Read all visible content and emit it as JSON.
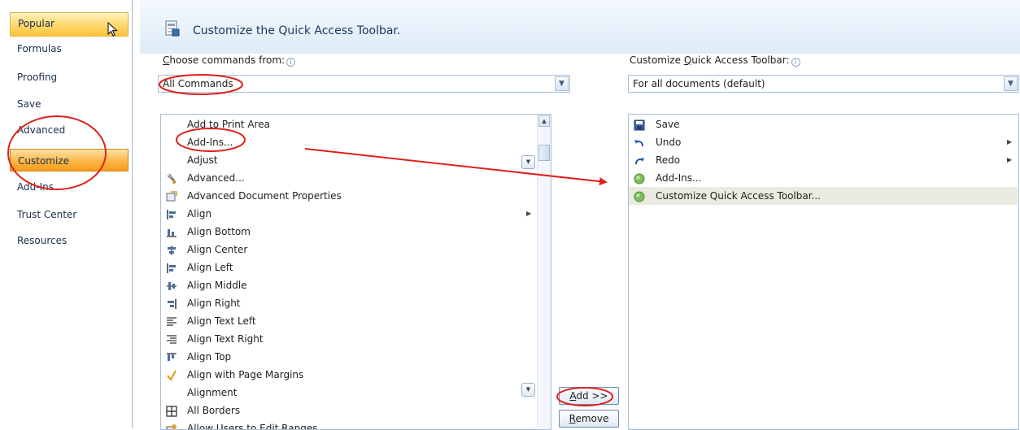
{
  "sidebar": {
    "items": [
      {
        "label": "Popular"
      },
      {
        "label": "Formulas"
      },
      {
        "label": "Proofing"
      },
      {
        "label": "Save"
      },
      {
        "label": "Advanced"
      },
      {
        "label": "Customize"
      },
      {
        "label": "Add-Ins"
      },
      {
        "label": "Trust Center"
      },
      {
        "label": "Resources"
      }
    ]
  },
  "header": {
    "title": "Customize the Quick Access Toolbar."
  },
  "choose": {
    "label_accel": "C",
    "label_rest": "hoose commands from:",
    "value": "All Commands"
  },
  "qat_target": {
    "label_pre": "Customize ",
    "label_accel": "Q",
    "label_rest": "uick Access Toolbar:",
    "value": "For all documents (default)"
  },
  "commands": [
    {
      "label": "Add to Print Area",
      "icon": "none"
    },
    {
      "label": "Add-Ins...",
      "icon": "none"
    },
    {
      "label": "Adjust",
      "icon": "none"
    },
    {
      "label": "Advanced...",
      "icon": "advanced-icon"
    },
    {
      "label": "Advanced Document Properties",
      "icon": "document-properties-icon"
    },
    {
      "label": "Align",
      "icon": "align-icon",
      "submenu": "▶"
    },
    {
      "label": "Align Bottom",
      "icon": "align-bottom-icon"
    },
    {
      "label": "Align Center",
      "icon": "align-center-icon"
    },
    {
      "label": "Align Left",
      "icon": "align-left-icon"
    },
    {
      "label": "Align Middle",
      "icon": "align-middle-icon"
    },
    {
      "label": "Align Right",
      "icon": "align-right-icon"
    },
    {
      "label": "Align Text Left",
      "icon": "align-text-left-icon"
    },
    {
      "label": "Align Text Right",
      "icon": "align-text-right-icon"
    },
    {
      "label": "Align Top",
      "icon": "align-top-icon"
    },
    {
      "label": "Align with Page Margins",
      "icon": "checkmark-icon"
    },
    {
      "label": "Alignment",
      "icon": "none"
    },
    {
      "label": "All Borders",
      "icon": "all-borders-icon"
    },
    {
      "label": "Allow Users to Edit Ranges...",
      "icon": "allow-edit-ranges-icon"
    }
  ],
  "qat_items": [
    {
      "label": "Save",
      "icon": "save-icon"
    },
    {
      "label": "Undo",
      "icon": "undo-icon",
      "submenu": "▶"
    },
    {
      "label": "Redo",
      "icon": "redo-icon",
      "submenu": "▶"
    },
    {
      "label": "Add-Ins...",
      "icon": "add-ins-icon"
    },
    {
      "label": "Customize Quick Access Toolbar...",
      "icon": "customize-icon",
      "selected": true
    }
  ],
  "buttons": {
    "add_accel": "A",
    "add_rest": "dd >>",
    "remove_accel": "R",
    "remove_rest": "emove"
  },
  "glyphs": {
    "dropdown_arrow": "▼",
    "scroll_up": "▲",
    "expand": "▼",
    "info": "i"
  },
  "colors": {
    "annotation_red": "#e0201b",
    "selected_orange": "#f89b17",
    "popular_yellow": "#ffd76c"
  }
}
